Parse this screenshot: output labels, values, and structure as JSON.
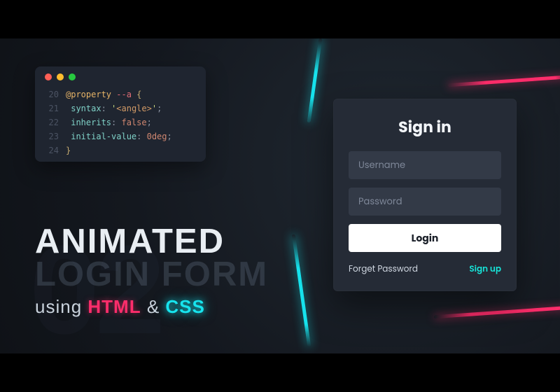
{
  "editor": {
    "lines": [
      {
        "num": "20",
        "tokens": [
          {
            "cls": "tok-atrule",
            "t": "@property "
          },
          {
            "cls": "tok-var",
            "t": "--a"
          },
          {
            "cls": "tok-punct",
            "t": " "
          },
          {
            "cls": "tok-brace",
            "t": "{"
          }
        ]
      },
      {
        "num": "21",
        "tokens": [
          {
            "cls": "tok-punct",
            "t": "  "
          },
          {
            "cls": "tok-prop",
            "t": "syntax"
          },
          {
            "cls": "tok-punct",
            "t": ": "
          },
          {
            "cls": "tok-str",
            "t": "'"
          },
          {
            "cls": "tok-tag",
            "t": "<angle>"
          },
          {
            "cls": "tok-str",
            "t": "'"
          },
          {
            "cls": "tok-punct",
            "t": ";"
          }
        ]
      },
      {
        "num": "22",
        "tokens": [
          {
            "cls": "tok-punct",
            "t": "  "
          },
          {
            "cls": "tok-prop",
            "t": "inherits"
          },
          {
            "cls": "tok-punct",
            "t": ": "
          },
          {
            "cls": "tok-bool",
            "t": "false"
          },
          {
            "cls": "tok-punct",
            "t": ";"
          }
        ]
      },
      {
        "num": "23",
        "tokens": [
          {
            "cls": "tok-punct",
            "t": "  "
          },
          {
            "cls": "tok-prop",
            "t": "initial-value"
          },
          {
            "cls": "tok-punct",
            "t": ": "
          },
          {
            "cls": "tok-num",
            "t": "0deg"
          },
          {
            "cls": "tok-punct",
            "t": ";"
          }
        ]
      },
      {
        "num": "24",
        "tokens": [
          {
            "cls": "tok-brace",
            "t": "}"
          }
        ]
      }
    ]
  },
  "headline": {
    "line1": "ANIMATED",
    "line2": "LOGIN FORM",
    "using": "using ",
    "html": "HTML",
    "amp": " & ",
    "css": "CSS",
    "bgnum": "02"
  },
  "form": {
    "title": "Sign in",
    "username_placeholder": "Username",
    "password_placeholder": "Password",
    "login_label": "Login",
    "forget_label": "Forget Password",
    "signup_label": "Sign up"
  },
  "colors": {
    "accent_cyan": "#17e4ee",
    "accent_pink": "#ff2d6b",
    "card_bg": "#252b36",
    "field_bg": "#333a47"
  }
}
